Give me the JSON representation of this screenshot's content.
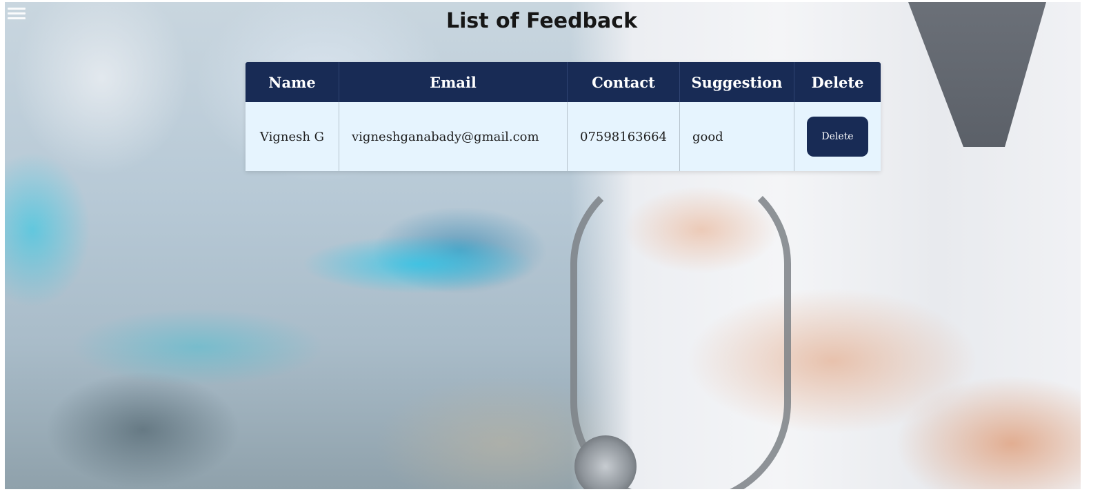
{
  "header": {
    "menu_icon": "hamburger-menu-icon",
    "title": "List of Feedback"
  },
  "table": {
    "columns": [
      "Name",
      "Email",
      "Contact",
      "Suggestion",
      "Delete"
    ],
    "rows": [
      {
        "name": "Vignesh G",
        "email": "vigneshganabady@gmail.com",
        "contact": "07598163664",
        "suggestion": "good",
        "delete_label": "Delete"
      }
    ]
  },
  "colors": {
    "header_bg": "#182b55",
    "row_bg": "#e6f4fe",
    "button_bg": "#182b55"
  }
}
